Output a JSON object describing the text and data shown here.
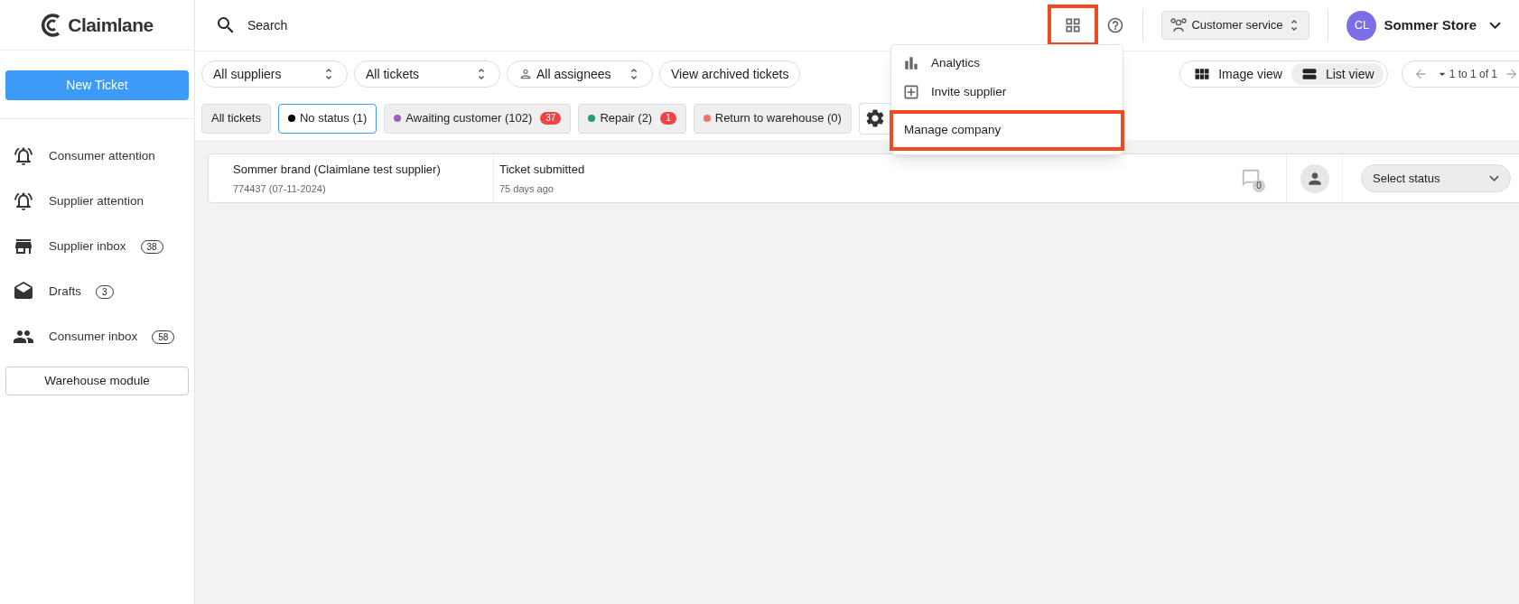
{
  "brand": {
    "name": "Claimlane"
  },
  "header": {
    "search": {
      "label": "Search"
    },
    "apps_button": {
      "highlighted": true
    },
    "role_select": {
      "value": "Customer service"
    },
    "account": {
      "initials": "CL",
      "name": "Sommer Store"
    }
  },
  "apps_menu": {
    "items": [
      {
        "label": "Analytics",
        "kind": "chart",
        "highlighted": false
      },
      {
        "label": "Invite supplier",
        "kind": "add",
        "highlighted": false
      },
      {
        "label": "Manage company",
        "kind": "plain",
        "highlighted": true
      }
    ]
  },
  "sidebar": {
    "new_ticket": "New Ticket",
    "items": [
      {
        "label": "Consumer attention",
        "kind": "bell"
      },
      {
        "label": "Supplier attention",
        "kind": "bell"
      },
      {
        "label": "Supplier inbox",
        "kind": "store",
        "count": "38"
      },
      {
        "label": "Drafts",
        "kind": "drafts",
        "count": "3"
      },
      {
        "label": "Consumer inbox",
        "kind": "people",
        "count": "58"
      }
    ],
    "warehouse_button": "Warehouse module"
  },
  "filters": [
    {
      "label": "All suppliers",
      "kind": "select"
    },
    {
      "label": "All tickets",
      "kind": "select"
    },
    {
      "label": "All assignees",
      "kind": "assignee"
    },
    {
      "label": "View archived tickets",
      "kind": "button"
    }
  ],
  "views": [
    {
      "label": "Image view",
      "kind": "grid",
      "selected": false
    },
    {
      "label": "List view",
      "kind": "list",
      "selected": true
    }
  ],
  "pagination": {
    "label": "1 to 1 of 1"
  },
  "status_tabs": [
    {
      "label": "All tickets",
      "selected": false
    },
    {
      "label": "No status (1)",
      "selected": true,
      "color": "#000000"
    },
    {
      "label": "Awaiting customer (102)",
      "selected": false,
      "color": "#a259c4",
      "badge": "37"
    },
    {
      "label": "Repair (2)",
      "selected": false,
      "color": "#1f9e7e",
      "badge": "1"
    },
    {
      "label": "Return to warehouse (0)",
      "selected": false,
      "color": "#f07070"
    }
  ],
  "tickets": [
    {
      "supplier": "Sommer brand (Claimlane test supplier)",
      "reference": "774437 (07-11-2024)",
      "event": "Ticket submitted",
      "time": "75 days ago",
      "comments": "0",
      "status_placeholder": "Select status"
    }
  ]
}
